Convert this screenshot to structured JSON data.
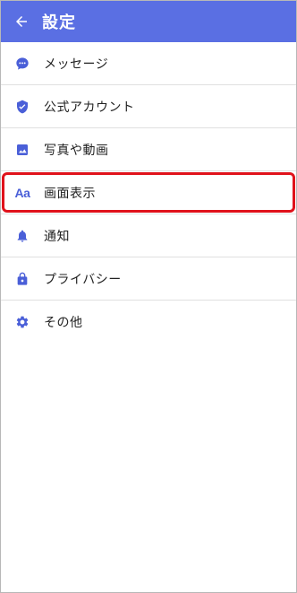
{
  "header": {
    "title": "設定",
    "back_icon": "arrow-left-icon",
    "background_color": "#5a6fe3"
  },
  "menu": {
    "items": [
      {
        "label": "メッセージ",
        "icon": "chat-bubble-icon"
      },
      {
        "label": "公式アカウント",
        "icon": "shield-check-icon"
      },
      {
        "label": "写真や動画",
        "icon": "image-icon"
      },
      {
        "label": "画面表示",
        "icon": "font-size-icon",
        "icon_text": "Aa",
        "highlighted": true
      },
      {
        "label": "通知",
        "icon": "bell-icon"
      },
      {
        "label": "プライバシー",
        "icon": "lock-icon"
      },
      {
        "label": "その他",
        "icon": "gear-icon"
      }
    ]
  },
  "colors": {
    "accent": "#4a5fd8",
    "highlight": "#e0121b"
  }
}
